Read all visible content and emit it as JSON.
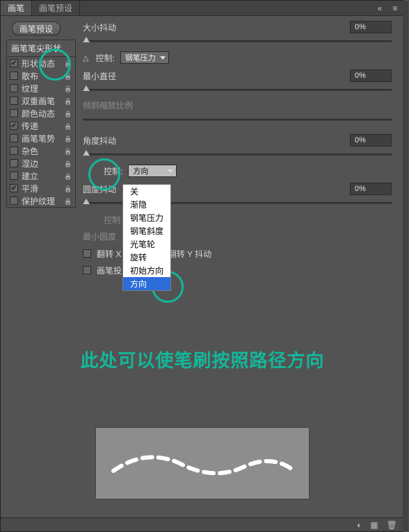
{
  "tabs": {
    "brush": "画笔",
    "presets": "画笔预设"
  },
  "preset_button": "画笔预设",
  "sidebar": {
    "header": "画笔笔尖形状",
    "items": [
      {
        "label": "形状动态",
        "checked": true
      },
      {
        "label": "散布",
        "checked": false
      },
      {
        "label": "纹理",
        "checked": false
      },
      {
        "label": "双重画笔",
        "checked": false
      },
      {
        "label": "颜色动态",
        "checked": false
      },
      {
        "label": "传递",
        "checked": true
      },
      {
        "label": "画笔笔势",
        "checked": false
      },
      {
        "label": "杂色",
        "checked": false
      },
      {
        "label": "湿边",
        "checked": false
      },
      {
        "label": "建立",
        "checked": false
      },
      {
        "label": "平滑",
        "checked": true
      },
      {
        "label": "保护纹理",
        "checked": false
      }
    ]
  },
  "settings": {
    "size_jitter": {
      "title": "大小抖动",
      "value": "0%"
    },
    "control1": {
      "label": "控制:",
      "value": "钢笔压力"
    },
    "min_diameter": {
      "title": "最小直径",
      "value": "0%"
    },
    "tilt_scale": {
      "title": "倾斜缩放比例"
    },
    "angle_jitter": {
      "title": "角度抖动",
      "value": "0%"
    },
    "control2": {
      "label": "控制:",
      "value": "方向"
    },
    "round_jitter": {
      "title": "圆度抖动",
      "value": "0%"
    },
    "control3": {
      "label": "控制:"
    },
    "min_round": {
      "title": "最小圆度"
    },
    "flip_x": "翻转 X 抖动",
    "flip_y": "翻转 Y 抖动",
    "projection": "画笔投影"
  },
  "dropdown": {
    "options": [
      "关",
      "渐隐",
      "钢笔压力",
      "钢笔斜度",
      "光笔轮",
      "旋转",
      "初始方向",
      "方向"
    ],
    "selected": "方向"
  },
  "annotation_text": "此处可以使笔刷按照路径方向"
}
